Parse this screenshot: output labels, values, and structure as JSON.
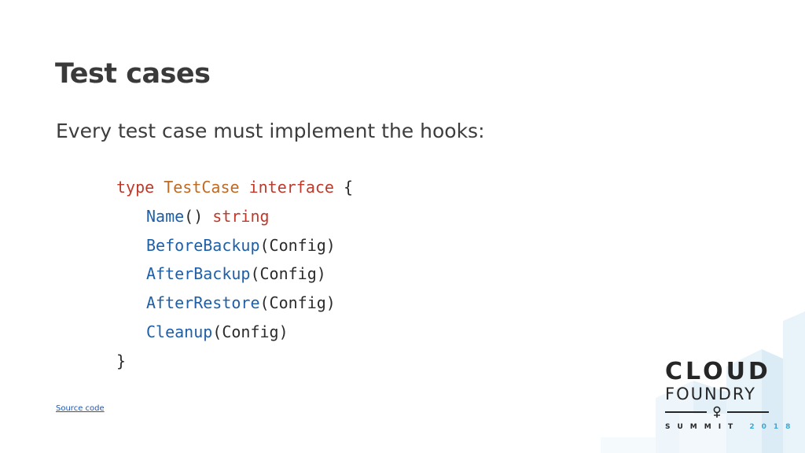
{
  "slide": {
    "title": "Test cases",
    "subtitle": "Every test case must implement the hooks:",
    "source_link": "Source code"
  },
  "code": {
    "line1": {
      "kw_type": "type",
      "type_name": "TestCase",
      "kw_interface": "interface",
      "brace_open": " {"
    },
    "line2": {
      "fn": "Name",
      "args": "() ",
      "ret": "string"
    },
    "line3": {
      "fn": "BeforeBackup",
      "args": "(Config)"
    },
    "line4": {
      "fn": "AfterBackup",
      "args": "(Config)"
    },
    "line5": {
      "fn": "AfterRestore",
      "args": "(Config)"
    },
    "line6": {
      "fn": "Cleanup",
      "args": "(Config)"
    },
    "line7": {
      "brace_close": "}"
    }
  },
  "logo": {
    "line1": "CLOUD",
    "line2": "FOUNDRY",
    "event": "SUMMIT",
    "year": "2018"
  },
  "colors": {
    "keyword": "#c0392b",
    "type": "#c26a1f",
    "function": "#1e5fa8",
    "year_accent": "#3aa7d8"
  }
}
